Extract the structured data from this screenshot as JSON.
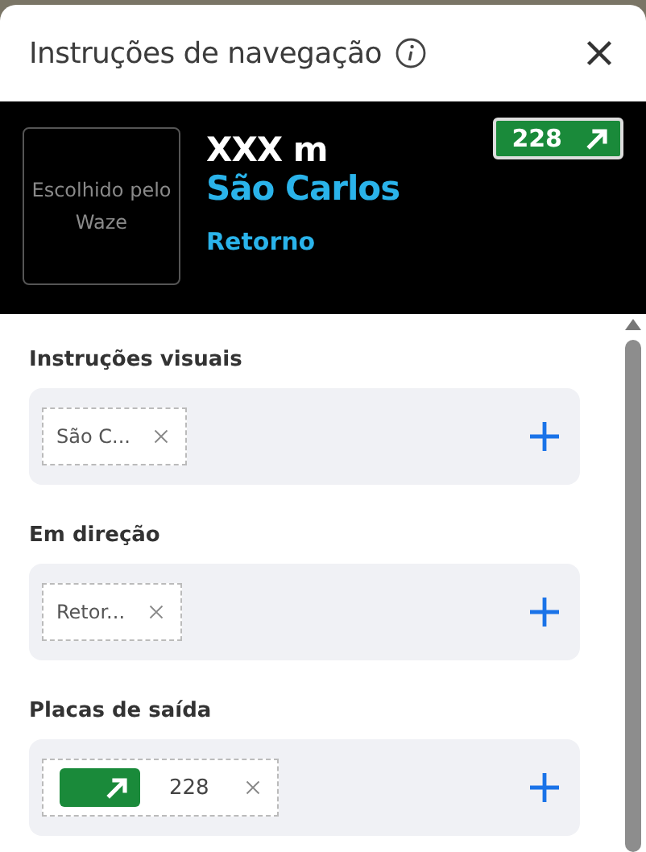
{
  "header": {
    "title": "Instruções de navegação"
  },
  "preview": {
    "placeholder_text": "Escolhido pelo Waze",
    "distance": "XXX m",
    "destination": "São Carlos",
    "direction": "Retorno",
    "sign": {
      "number": "228"
    }
  },
  "sections": [
    {
      "label": "Instruções visuais",
      "items": [
        {
          "kind": "text",
          "text": "São C..."
        }
      ]
    },
    {
      "label": "Em direção",
      "items": [
        {
          "kind": "text",
          "text": "Retor..."
        }
      ]
    },
    {
      "label": "Placas de saída",
      "items": [
        {
          "kind": "sign",
          "text": "228"
        }
      ]
    }
  ]
}
